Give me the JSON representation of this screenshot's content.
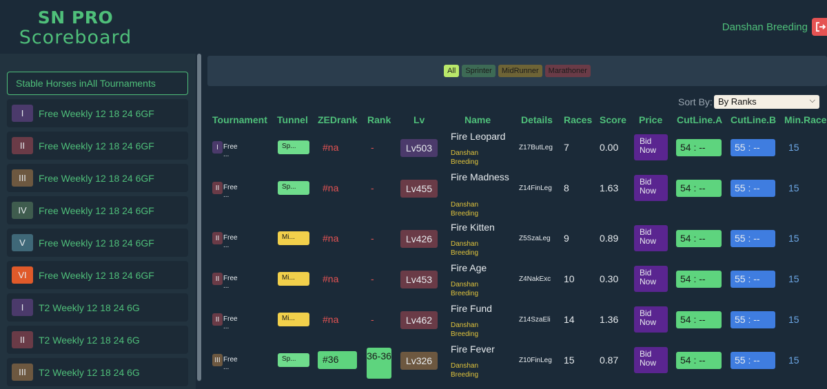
{
  "app": {
    "title_line1": "SN PRO",
    "title_line2": "Scoreboard",
    "user_name": "Danshan Breeding",
    "logout_icon": "logout-icon"
  },
  "sidebar": {
    "header": "Stable Horses inAll Tournaments",
    "items": [
      {
        "badge": "I",
        "label": "Free Weekly 12 18 24 6GF",
        "color": "#4b3a6b"
      },
      {
        "badge": "II",
        "label": "Free Weekly 12 18 24 6GF",
        "color": "#6a3b47"
      },
      {
        "badge": "III",
        "label": "Free Weekly 12 18 24 6GF",
        "color": "#6d5840"
      },
      {
        "badge": "IV",
        "label": "Free Weekly 12 18 24 6GF",
        "color": "#3f5c4e"
      },
      {
        "badge": "V",
        "label": "Free Weekly 12 18 24 6GF",
        "color": "#3f6878"
      },
      {
        "badge": "VI",
        "label": "Free Weekly 12 18 24 6GF",
        "color": "#e05a2a"
      },
      {
        "badge": "I",
        "label": "T2 Weekly 12 18 24 6G",
        "color": "#4b3a6b"
      },
      {
        "badge": "II",
        "label": "T2 Weekly 12 18 24 6G",
        "color": "#6a3b47"
      },
      {
        "badge": "III",
        "label": "T2 Weekly 12 18 24 6G",
        "color": "#6d5840"
      }
    ]
  },
  "filters": [
    {
      "label": "All",
      "color": "#b9e86a",
      "text": "#1a1a1a"
    },
    {
      "label": "Sprinter",
      "color": "#3d6a55",
      "text": "#1a1a1a"
    },
    {
      "label": "MidRunner",
      "color": "#6e6436",
      "text": "#1a1a1a"
    },
    {
      "label": "Marathoner",
      "color": "#6a3b47",
      "text": "#1a1a1a"
    }
  ],
  "sort": {
    "label": "Sort By:",
    "selected": "By Ranks"
  },
  "table": {
    "headers": {
      "tournament": "Tournament",
      "tunnel": "Tunnel",
      "zedrank": "ZEDrank",
      "rank": "Rank",
      "lv": "Lv",
      "name": "Name",
      "details": "Details",
      "races": "Races",
      "score": "Score",
      "price": "Price",
      "cutline_a": "CutLine.A",
      "cutline_b": "CutLine.B",
      "min_races": "Min.Races"
    },
    "rows": [
      {
        "t_badge": "I",
        "t_color": "#4b3a6b",
        "t_name": "Free ...",
        "tunnel": "Sp...",
        "tunnel_color": "#6fdc8c",
        "zedrank": "#na",
        "rank": "-",
        "lv": "Lv503",
        "lv_color": "#4b3a6b",
        "name": "Fire Leopard",
        "owner": "Danshan Breeding",
        "details": "Z17ButLeg",
        "races": "7",
        "score": "0.00",
        "price": "Bid Now",
        "cut_a": "54 : --",
        "cut_b": "55 : --",
        "min_races": "15"
      },
      {
        "t_badge": "II",
        "t_color": "#6a3b47",
        "t_name": "Free ...",
        "tunnel": "Sp...",
        "tunnel_color": "#6fdc8c",
        "zedrank": "#na",
        "rank": "-",
        "lv": "Lv455",
        "lv_color": "#6a3b47",
        "name": "Fire Madness",
        "owner": "Danshan Breeding",
        "details": "Z14FinLeg",
        "races": "8",
        "score": "1.63",
        "price": "Bid Now",
        "cut_a": "54 : --",
        "cut_b": "55 : --",
        "min_races": "15"
      },
      {
        "t_badge": "II",
        "t_color": "#6a3b47",
        "t_name": "Free ...",
        "tunnel": "Mi...",
        "tunnel_color": "#f2d04b",
        "zedrank": "#na",
        "rank": "-",
        "lv": "Lv426",
        "lv_color": "#6a3b47",
        "name": "Fire Kitten",
        "owner": "Danshan Breeding",
        "details": "Z5SzaLeg",
        "races": "9",
        "score": "0.89",
        "price": "Bid Now",
        "cut_a": "54 : --",
        "cut_b": "55 : --",
        "min_races": "15"
      },
      {
        "t_badge": "II",
        "t_color": "#6a3b47",
        "t_name": "Free ...",
        "tunnel": "Mi...",
        "tunnel_color": "#f2d04b",
        "zedrank": "#na",
        "rank": "-",
        "lv": "Lv453",
        "lv_color": "#6a3b47",
        "name": "Fire Age",
        "owner": "Danshan Breeding",
        "details": "Z4NakExc",
        "races": "10",
        "score": "0.30",
        "price": "Bid Now",
        "cut_a": "54 : --",
        "cut_b": "55 : --",
        "min_races": "15"
      },
      {
        "t_badge": "II",
        "t_color": "#6a3b47",
        "t_name": "Free ...",
        "tunnel": "Mi...",
        "tunnel_color": "#f2d04b",
        "zedrank": "#na",
        "rank": "-",
        "lv": "Lv462",
        "lv_color": "#6a3b47",
        "name": "Fire Fund",
        "owner": "Danshan Breeding",
        "details": "Z14SzaEli",
        "races": "14",
        "score": "1.36",
        "price": "Bid Now",
        "cut_a": "54 : --",
        "cut_b": "55 : --",
        "min_races": "15"
      },
      {
        "t_badge": "III",
        "t_color": "#6d5840",
        "t_name": "Free ...",
        "tunnel": "Sp...",
        "tunnel_color": "#6fdc8c",
        "zedrank": "#36",
        "rank": "36-36",
        "lv": "Lv326",
        "lv_color": "#6d5840",
        "name": "Fire Fever",
        "owner": "Danshan Breeding",
        "details": "Z10FinLeg",
        "races": "15",
        "score": "0.87",
        "price": "Bid Now",
        "cut_a": "54 : --",
        "cut_b": "55 : --",
        "min_races": "15"
      }
    ]
  }
}
